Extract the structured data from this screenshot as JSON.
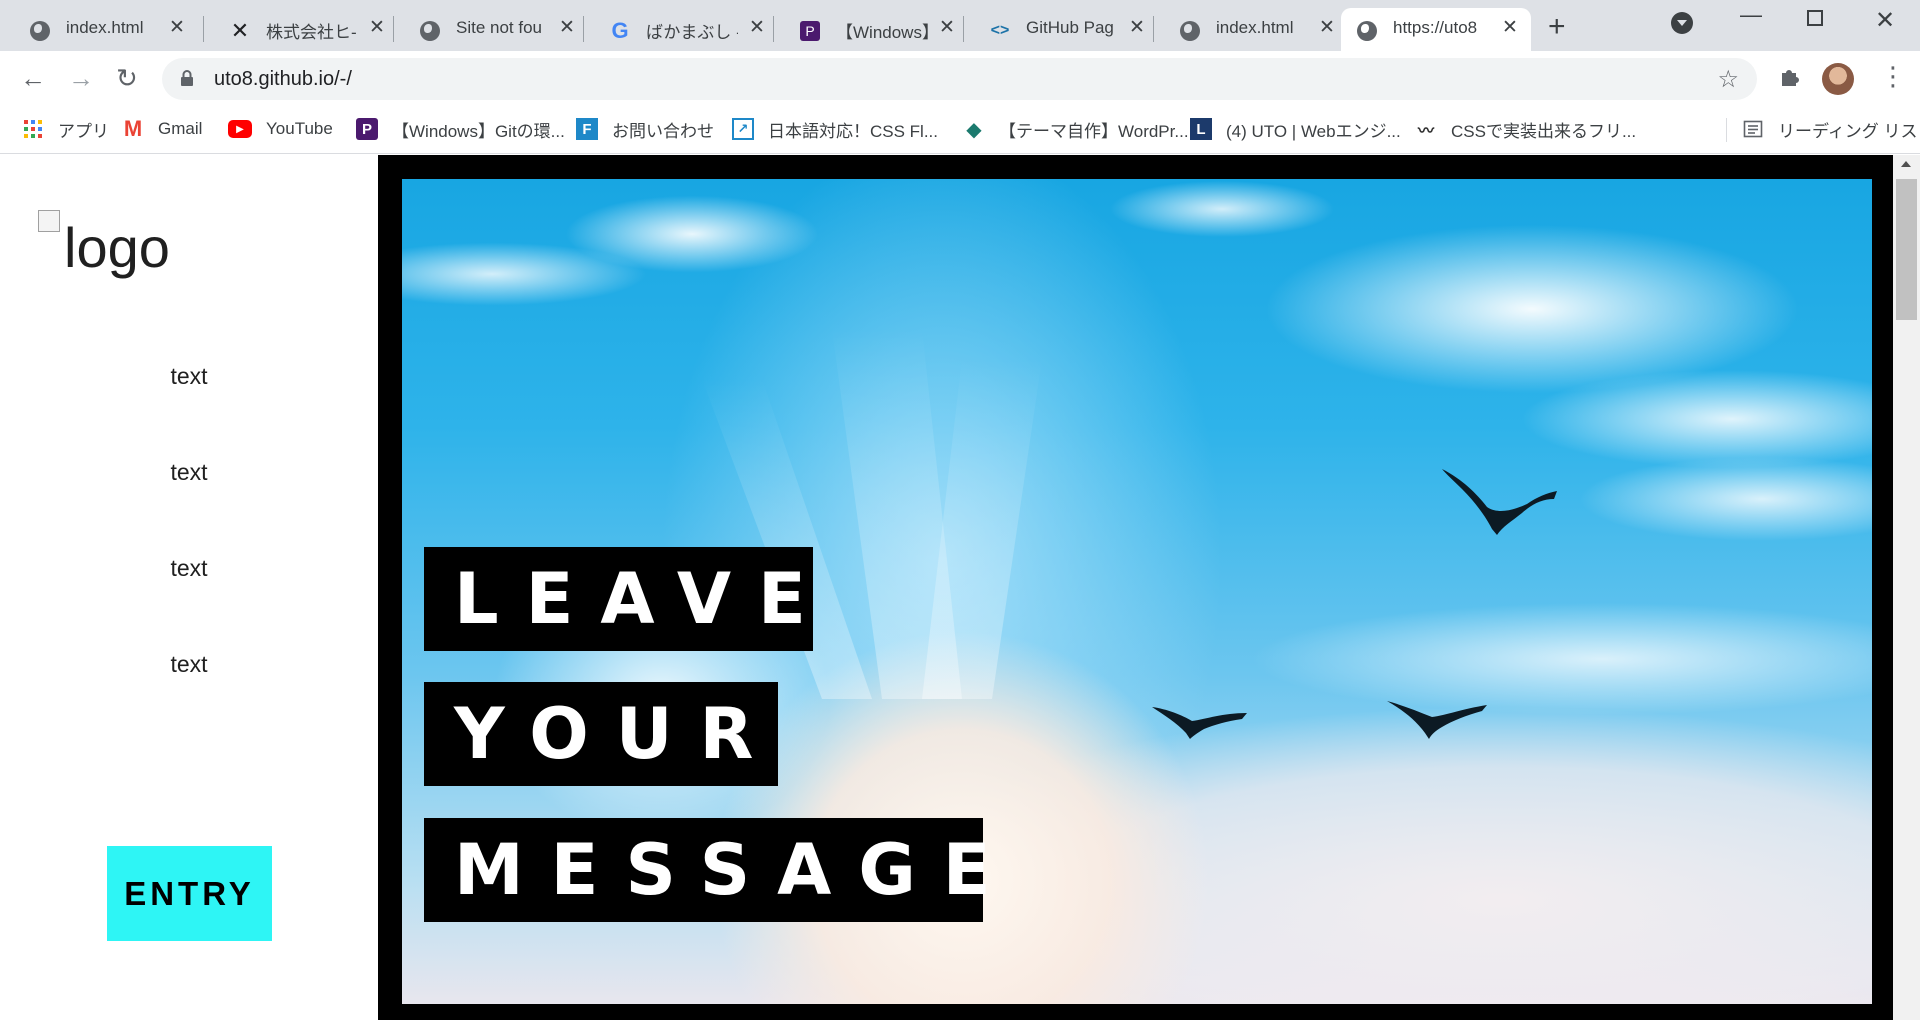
{
  "tabs": [
    {
      "title": "index.html",
      "icon": "globe-icon"
    },
    {
      "title": "株式会社ヒ‐",
      "icon": "x-logo-icon"
    },
    {
      "title": "Site not fou",
      "icon": "globe-icon"
    },
    {
      "title": "ばかまぶし - G",
      "icon": "google-g-icon"
    },
    {
      "title": "【Windows】",
      "icon": "purple-p-icon"
    },
    {
      "title": "GitHub Pag",
      "icon": "code-brackets-icon"
    },
    {
      "title": "index.html",
      "icon": "globe-icon"
    },
    {
      "title": "https://uto8",
      "icon": "globe-icon",
      "active": true
    }
  ],
  "address": {
    "url": "uto8.github.io/-/"
  },
  "bookmarks": [
    {
      "label": "アプリ",
      "icon": "apps-grid-icon"
    },
    {
      "label": "Gmail",
      "icon": "gmail-icon"
    },
    {
      "label": "YouTube",
      "icon": "youtube-icon"
    },
    {
      "label": "【Windows】Gitの環...",
      "icon": "purple-p-icon"
    },
    {
      "label": "お問い合わせ",
      "icon": "blue-f-icon"
    },
    {
      "label": "日本語対応！CSS Fl...",
      "icon": "external-box-icon"
    },
    {
      "label": "【テーマ自作】WordPr...",
      "icon": "green-diamond-icon"
    },
    {
      "label": "(4) UTO | Webエンジ...",
      "icon": "blue-l-icon"
    },
    {
      "label": "CSSで実装出来るフリ...",
      "icon": "squiggle-icon"
    },
    {
      "label": "リーディング リスト",
      "icon": "reading-list-icon"
    }
  ],
  "page": {
    "logo_alt": "logo",
    "nav": [
      "text",
      "text",
      "text",
      "text"
    ],
    "entry_label": "ENTRY",
    "hero_lines": [
      "LEAVE",
      "YOUR",
      "MESSAGE"
    ]
  },
  "colors": {
    "entry_bg": "#2ef5f5",
    "tab_strip": "#dee1e6",
    "omnibox": "#f1f3f4"
  }
}
